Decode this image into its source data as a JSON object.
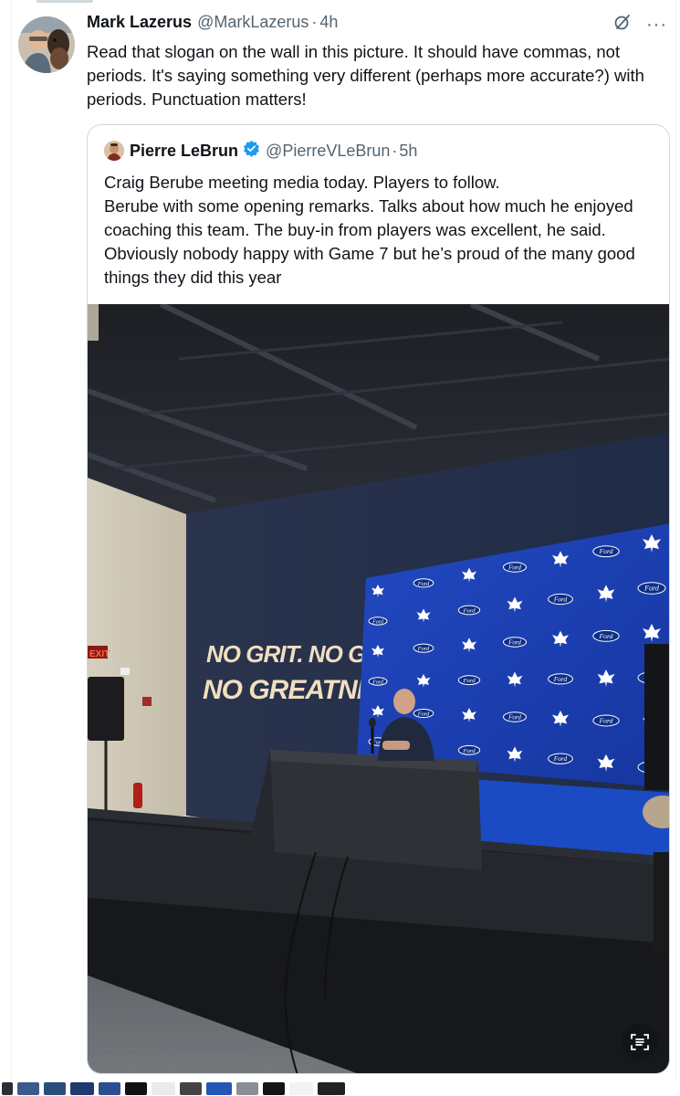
{
  "tweet": {
    "author_name": "Mark Lazerus",
    "author_handle": "@MarkLazerus",
    "separator": "·",
    "time": "4h",
    "text": "Read that slogan on the wall in this picture. It should have commas, not periods. It's saying something very different (perhaps more accurate?) with periods. Punctuation matters!",
    "more_icon": "more-icon",
    "grok_icon": "grok-icon"
  },
  "quote": {
    "author_name": "Pierre LeBrun",
    "author_handle": "@PierreVLeBrun",
    "separator": "·",
    "time": "5h",
    "verified_icon": "verified-badge-icon",
    "text": "Craig Berube meeting media today. Players to follow.\nBerube with some opening remarks. Talks about how much he enjoyed coaching this team. The buy-in from players was excellent, he said. Obviously nobody happy with Game 7 but he’s proud of the many good things they did this year",
    "photo": {
      "wall_slogan_line1": "NO GRIT. NO GRIND.",
      "wall_slogan_line2": "NO GREATNESS.",
      "exit_sign": "EXIT",
      "sponsor_text": "Ford",
      "alt_icon": "image-description-icon"
    }
  },
  "colors": {
    "text_primary": "#0f1419",
    "text_secondary": "#536471",
    "border": "#cfd9de",
    "verified_blue": "#1d9bf0",
    "backdrop_blue": "#1c3fa8"
  }
}
